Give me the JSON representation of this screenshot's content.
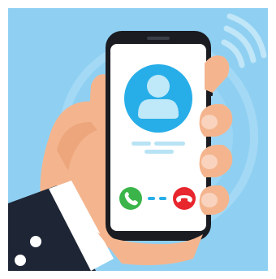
{
  "illustration": {
    "subject": "incoming-call",
    "icons": [
      "avatar-icon",
      "accept-call-icon",
      "decline-call-icon",
      "signal-waves-icon"
    ]
  },
  "colors": {
    "background": "#8fd0f2",
    "background_rings": "#a4d9f5",
    "phone_body": "#1a1c22",
    "screen": "#ffffff",
    "avatar_circle": "#27aee8",
    "avatar_figure": "#bfe8f8",
    "placeholder_text": "#b8e3f5",
    "accept_button": "#3bb54a",
    "decline_button": "#e8262d",
    "skin": "#f4b58e",
    "skin_shadow": "#e8976d",
    "nails": "#f9d3bd",
    "sleeve": "#1e2535",
    "shirt_cuff": "#ffffff",
    "waves": "#c0e6f8"
  },
  "call_state": "ringing"
}
